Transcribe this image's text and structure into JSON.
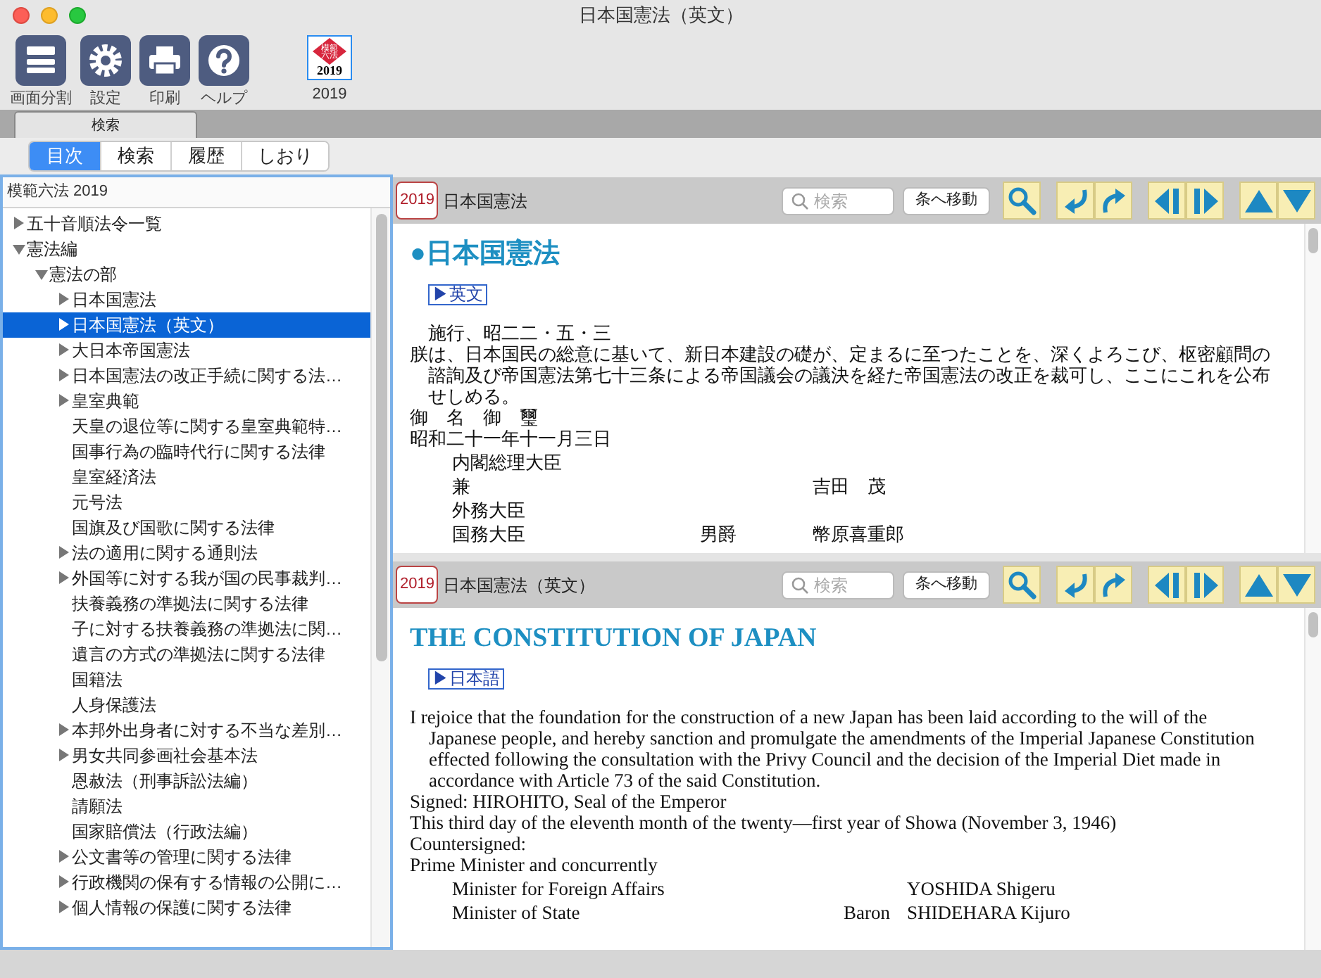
{
  "window": {
    "title": "日本国憲法（英文）"
  },
  "toolbar": {
    "buttons": [
      {
        "kind": "split",
        "label": "画面分割"
      },
      {
        "kind": "settings",
        "label": "設定"
      },
      {
        "kind": "print",
        "label": "印刷"
      },
      {
        "kind": "help",
        "label": "ヘルプ"
      }
    ],
    "book": {
      "mark": "模範六法",
      "year": "2019",
      "label": "2019"
    }
  },
  "tab_strip": [
    {
      "label": "検索",
      "selected": true
    }
  ],
  "view_tabs": [
    {
      "label": "目次",
      "selected": true
    },
    {
      "label": "検索",
      "selected": false
    },
    {
      "label": "履歴",
      "selected": false
    },
    {
      "label": "しおり",
      "selected": false
    }
  ],
  "sidebar": {
    "title": "模範六法 2019",
    "tree": [
      {
        "label": "五十音順法令一覧",
        "kind": "folder",
        "expanded": false,
        "selected": false
      },
      {
        "label": "憲法編",
        "kind": "folder",
        "expanded": true,
        "selected": false,
        "children": [
          {
            "label": "憲法の部",
            "kind": "folder",
            "expanded": true,
            "selected": false,
            "children": [
              {
                "label": "日本国憲法",
                "kind": "folder",
                "expanded": false,
                "selected": false
              },
              {
                "label": "日本国憲法（英文）",
                "kind": "folder",
                "expanded": false,
                "selected": true
              },
              {
                "label": "大日本帝国憲法",
                "kind": "folder",
                "expanded": false,
                "selected": false
              },
              {
                "label": "日本国憲法の改正手続に関する法…",
                "kind": "folder",
                "expanded": false,
                "selected": false
              },
              {
                "label": "皇室典範",
                "kind": "folder",
                "expanded": false,
                "selected": false
              },
              {
                "label": "天皇の退位等に関する皇室典範特…",
                "kind": "leaf",
                "selected": false
              },
              {
                "label": "国事行為の臨時代行に関する法律",
                "kind": "leaf",
                "selected": false
              },
              {
                "label": "皇室経済法",
                "kind": "leaf",
                "selected": false
              },
              {
                "label": "元号法",
                "kind": "leaf",
                "selected": false
              },
              {
                "label": "国旗及び国歌に関する法律",
                "kind": "leaf",
                "selected": false
              },
              {
                "label": "法の適用に関する通則法",
                "kind": "folder",
                "expanded": false,
                "selected": false
              },
              {
                "label": "外国等に対する我が国の民事裁判…",
                "kind": "folder",
                "expanded": false,
                "selected": false
              },
              {
                "label": "扶養義務の準拠法に関する法律",
                "kind": "leaf",
                "selected": false
              },
              {
                "label": "子に対する扶養義務の準拠法に関…",
                "kind": "leaf",
                "selected": false
              },
              {
                "label": "遺言の方式の準拠法に関する法律",
                "kind": "leaf",
                "selected": false
              },
              {
                "label": "国籍法",
                "kind": "leaf",
                "selected": false
              },
              {
                "label": "人身保護法",
                "kind": "leaf",
                "selected": false
              },
              {
                "label": "本邦外出身者に対する不当な差別…",
                "kind": "folder",
                "expanded": false,
                "selected": false
              },
              {
                "label": "男女共同参画社会基本法",
                "kind": "folder",
                "expanded": false,
                "selected": false
              },
              {
                "label": "恩赦法（刑事訴訟法編）",
                "kind": "leaf",
                "selected": false
              },
              {
                "label": "請願法",
                "kind": "leaf",
                "selected": false
              },
              {
                "label": "国家賠償法（行政法編）",
                "kind": "leaf",
                "selected": false
              },
              {
                "label": "公文書等の管理に関する法律",
                "kind": "folder",
                "expanded": false,
                "selected": false
              },
              {
                "label": "行政機関の保有する情報の公開に…",
                "kind": "folder",
                "expanded": false,
                "selected": false
              },
              {
                "label": "個人情報の保護に関する法律",
                "kind": "folder",
                "expanded": false,
                "selected": false
              }
            ]
          }
        ]
      }
    ]
  },
  "panes": [
    {
      "badge": "2019",
      "title": "日本国憲法",
      "search": {
        "placeholder": "検索"
      },
      "goto_button": "条へ移動",
      "blocks": [
        {
          "kind": "heading",
          "text": "●日本国憲法"
        },
        {
          "kind": "link",
          "text": "▶英文"
        },
        {
          "kind": "note",
          "text": "施行、昭二二・五・三"
        },
        {
          "kind": "para",
          "text": "朕は、日本国民の総意に基いて、新日本建設の礎が、定まるに至つたことを、深くよろこび、枢密顧問の諮詢及び帝国憲法第七十三条による帝国議会の議決を経た帝国憲法の改正を裁可し、ここにこれを公布せしめる。"
        },
        {
          "kind": "line",
          "text": "御　名　御　璽"
        },
        {
          "kind": "line",
          "text": "昭和二十一年十一月三日"
        },
        {
          "kind": "sign",
          "cells": [
            "内閣総理大臣"
          ]
        },
        {
          "kind": "sign",
          "cells": [
            "兼",
            "",
            "吉田　茂"
          ]
        },
        {
          "kind": "sign",
          "cells": [
            "外務大臣"
          ]
        },
        {
          "kind": "sign",
          "cells": [
            "国務大臣",
            "男爵",
            "幣原喜重郎"
          ]
        }
      ]
    },
    {
      "badge": "2019",
      "title": "日本国憲法（英文）",
      "search": {
        "placeholder": "検索"
      },
      "goto_button": "条へ移動",
      "blocks": [
        {
          "kind": "heading",
          "text": "THE CONSTITUTION OF JAPAN"
        },
        {
          "kind": "link",
          "text": "▶日本語"
        },
        {
          "kind": "para",
          "text": "I rejoice that the foundation for the construction of a new Japan has been laid according to the will of the Japanese people, and hereby sanction and promulgate the amendments of the Imperial Japanese Constitution effected following the consultation with the Privy Council and the decision of the Imperial Diet made in accordance with Article 73 of the said Constitution."
        },
        {
          "kind": "line",
          "text": "Signed: HIROHITO, Seal of the Emperor"
        },
        {
          "kind": "line",
          "text": "This third day of the eleventh month of the twenty—first year of Showa (November 3, 1946)"
        },
        {
          "kind": "line",
          "text": "Countersigned:"
        },
        {
          "kind": "line",
          "text": "Prime Minister and concurrently"
        },
        {
          "kind": "sign",
          "cells": [
            "Minister for Foreign Affairs",
            "",
            "YOSHIDA Shigeru"
          ]
        },
        {
          "kind": "sign",
          "cells": [
            "Minister of State",
            "Baron",
            "SHIDEHARA Kijuro"
          ]
        }
      ]
    }
  ]
}
